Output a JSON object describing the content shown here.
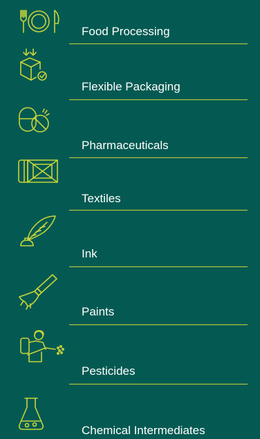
{
  "accent_color": "#c8d43a",
  "background_color": "#045a52",
  "items": [
    {
      "label": "Food Processing",
      "icon": "fork-plate-knife-icon"
    },
    {
      "label": "Flexible Packaging",
      "icon": "package-box-icon"
    },
    {
      "label": "Pharmaceuticals",
      "icon": "capsule-pill-icon"
    },
    {
      "label": "Textiles",
      "icon": "fabric-roll-icon"
    },
    {
      "label": "Ink",
      "icon": "quill-inkwell-icon"
    },
    {
      "label": "Paints",
      "icon": "paint-brush-icon"
    },
    {
      "label": "Pesticides",
      "icon": "sprayer-worker-icon"
    },
    {
      "label": "Chemical Intermediates",
      "icon": "flask-icon"
    }
  ]
}
